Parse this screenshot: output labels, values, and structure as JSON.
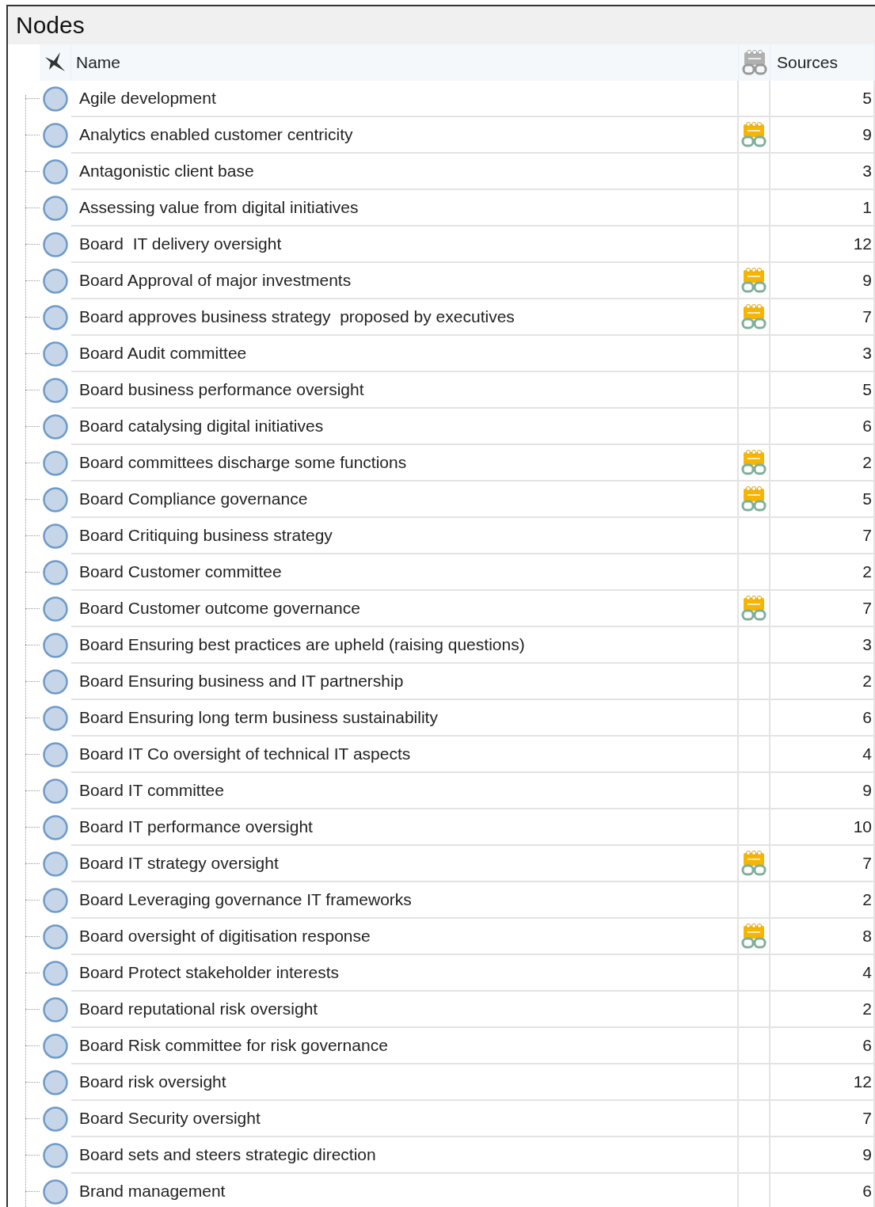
{
  "panel": {
    "title": "Nodes"
  },
  "columns": [
    {
      "label": "Name"
    },
    {
      "label": "Sources"
    }
  ],
  "rows": [
    {
      "name": "Agile development",
      "memo_linked": false,
      "sources": "5"
    },
    {
      "name": "Analytics enabled customer centricity",
      "memo_linked": true,
      "sources": "9"
    },
    {
      "name": "Antagonistic client base",
      "memo_linked": false,
      "sources": "3"
    },
    {
      "name": "Assessing value from digital initiatives",
      "memo_linked": false,
      "sources": "1"
    },
    {
      "name": "Board  IT delivery oversight",
      "memo_linked": false,
      "sources": "12"
    },
    {
      "name": "Board Approval of major investments",
      "memo_linked": true,
      "sources": "9"
    },
    {
      "name": "Board approves business strategy  proposed by executives",
      "memo_linked": true,
      "sources": "7"
    },
    {
      "name": "Board Audit committee",
      "memo_linked": false,
      "sources": "3"
    },
    {
      "name": "Board business performance oversight",
      "memo_linked": false,
      "sources": "5"
    },
    {
      "name": "Board catalysing digital initiatives",
      "memo_linked": false,
      "sources": "6"
    },
    {
      "name": "Board committees discharge some functions",
      "memo_linked": true,
      "sources": "2"
    },
    {
      "name": "Board Compliance governance",
      "memo_linked": true,
      "sources": "5"
    },
    {
      "name": "Board Critiquing business strategy",
      "memo_linked": false,
      "sources": "7"
    },
    {
      "name": "Board Customer committee",
      "memo_linked": false,
      "sources": "2"
    },
    {
      "name": "Board Customer outcome governance",
      "memo_linked": true,
      "sources": "7"
    },
    {
      "name": "Board Ensuring best practices are upheld (raising questions)",
      "memo_linked": false,
      "sources": "3"
    },
    {
      "name": "Board Ensuring business and IT partnership",
      "memo_linked": false,
      "sources": "2"
    },
    {
      "name": "Board Ensuring long term business sustainability",
      "memo_linked": false,
      "sources": "6"
    },
    {
      "name": "Board IT Co oversight of technical IT aspects",
      "memo_linked": false,
      "sources": "4"
    },
    {
      "name": "Board IT committee",
      "memo_linked": false,
      "sources": "9"
    },
    {
      "name": "Board IT performance oversight",
      "memo_linked": false,
      "sources": "10"
    },
    {
      "name": "Board IT strategy oversight",
      "memo_linked": true,
      "sources": "7"
    },
    {
      "name": "Board Leveraging governance IT frameworks",
      "memo_linked": false,
      "sources": "2"
    },
    {
      "name": "Board oversight of digitisation response",
      "memo_linked": true,
      "sources": "8"
    },
    {
      "name": "Board Protect stakeholder interests",
      "memo_linked": false,
      "sources": "4"
    },
    {
      "name": "Board reputational risk oversight",
      "memo_linked": false,
      "sources": "2"
    },
    {
      "name": "Board Risk committee for risk governance",
      "memo_linked": false,
      "sources": "6"
    },
    {
      "name": "Board risk oversight",
      "memo_linked": false,
      "sources": "12"
    },
    {
      "name": "Board Security oversight",
      "memo_linked": false,
      "sources": "7"
    },
    {
      "name": "Board sets and steers strategic direction",
      "memo_linked": false,
      "sources": "9"
    },
    {
      "name": "Brand management",
      "memo_linked": false,
      "sources": "6"
    }
  ]
}
